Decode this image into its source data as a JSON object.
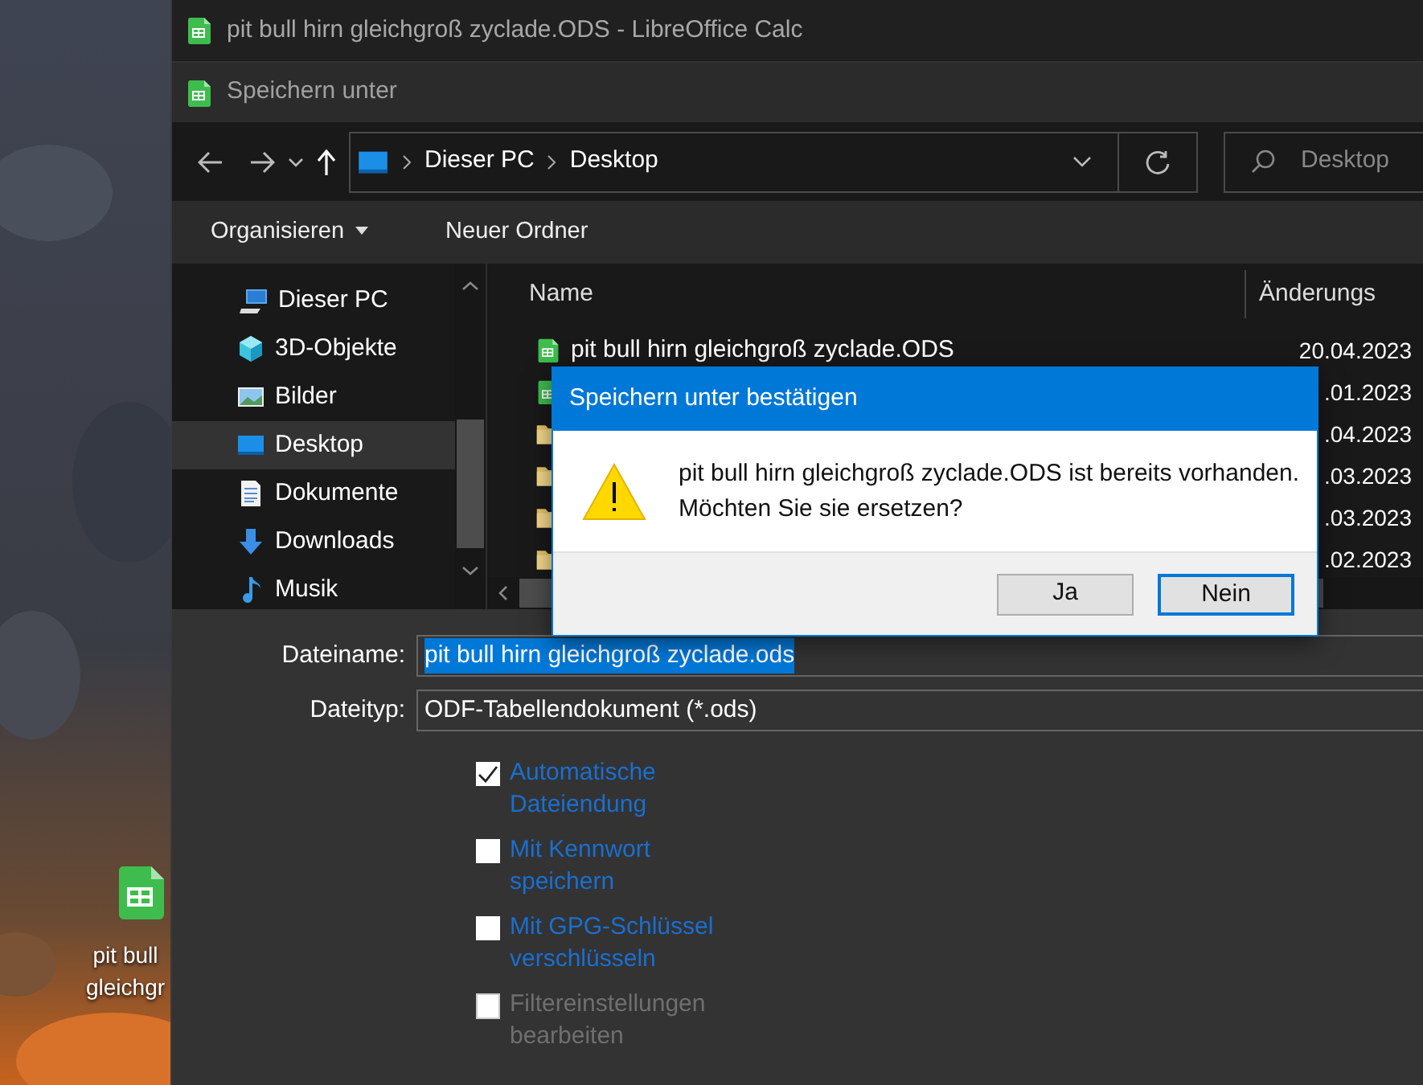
{
  "desktop": {
    "icon_label": [
      "pit bull",
      "gleichgr"
    ]
  },
  "app_window": {
    "title": "pit bull hirn gleichgroß zyclade.ODS - LibreOffice Calc"
  },
  "save_dialog": {
    "title": "Speichern unter",
    "breadcrumb": [
      "Dieser PC",
      "Desktop"
    ],
    "search": {
      "placeholder": "Desktop"
    },
    "toolbar": [
      {
        "label": "Organisieren",
        "dropdown": true
      },
      {
        "label": "Neuer Ordner",
        "dropdown": false
      }
    ],
    "nav_items": [
      {
        "label": "Dieser PC",
        "kind": "pc",
        "selected": false,
        "children": [
          {
            "label": "3D-Objekte",
            "kind": "cube",
            "selected": false
          },
          {
            "label": "Bilder",
            "kind": "pictures",
            "selected": false
          },
          {
            "label": "Desktop",
            "kind": "desktop",
            "selected": true
          },
          {
            "label": "Dokumente",
            "kind": "documents",
            "selected": false
          },
          {
            "label": "Downloads",
            "kind": "downloads",
            "selected": false
          },
          {
            "label": "Musik",
            "kind": "music",
            "selected": false
          }
        ]
      }
    ],
    "columns": [
      "Name",
      "Änderungs"
    ],
    "files": [
      {
        "kind": "spreadsheet",
        "name": "pit bull hirn gleichgroß zyclade.ODS",
        "date": "20.04.2023"
      },
      {
        "kind": "spreadsheet",
        "date": ".01.2023"
      },
      {
        "kind": "folder",
        "date": ".04.2023"
      },
      {
        "kind": "folder",
        "date": ".03.2023"
      },
      {
        "kind": "folder",
        "date": ".03.2023"
      },
      {
        "kind": "folder",
        "date": ".02.2023"
      }
    ],
    "filename": {
      "label": "Dateiname:",
      "value": "pit bull hirn gleichgroß zyclade.ods"
    },
    "filetype": {
      "label": "Dateityp:",
      "value": "ODF-Tabellendokument (*.ods)"
    },
    "options": [
      {
        "label": "Automatische Dateiendung",
        "checked": true,
        "disabled": false
      },
      {
        "label": "Mit Kennwort speichern",
        "checked": false,
        "disabled": false
      },
      {
        "label": "Mit GPG-Schlüssel verschlüsseln",
        "checked": false,
        "disabled": false
      },
      {
        "label": "Filtereinstellungen bearbeiten",
        "checked": false,
        "disabled": true
      }
    ]
  },
  "confirm": {
    "title": "Speichern unter bestätigen",
    "message": [
      "pit bull hirn gleichgroß zyclade.ODS ist bereits vorhanden.",
      "Möchten Sie sie ersetzen?"
    ],
    "buttons": [
      {
        "label": "Ja",
        "default": false
      },
      {
        "label": "Nein",
        "default": true
      }
    ]
  }
}
